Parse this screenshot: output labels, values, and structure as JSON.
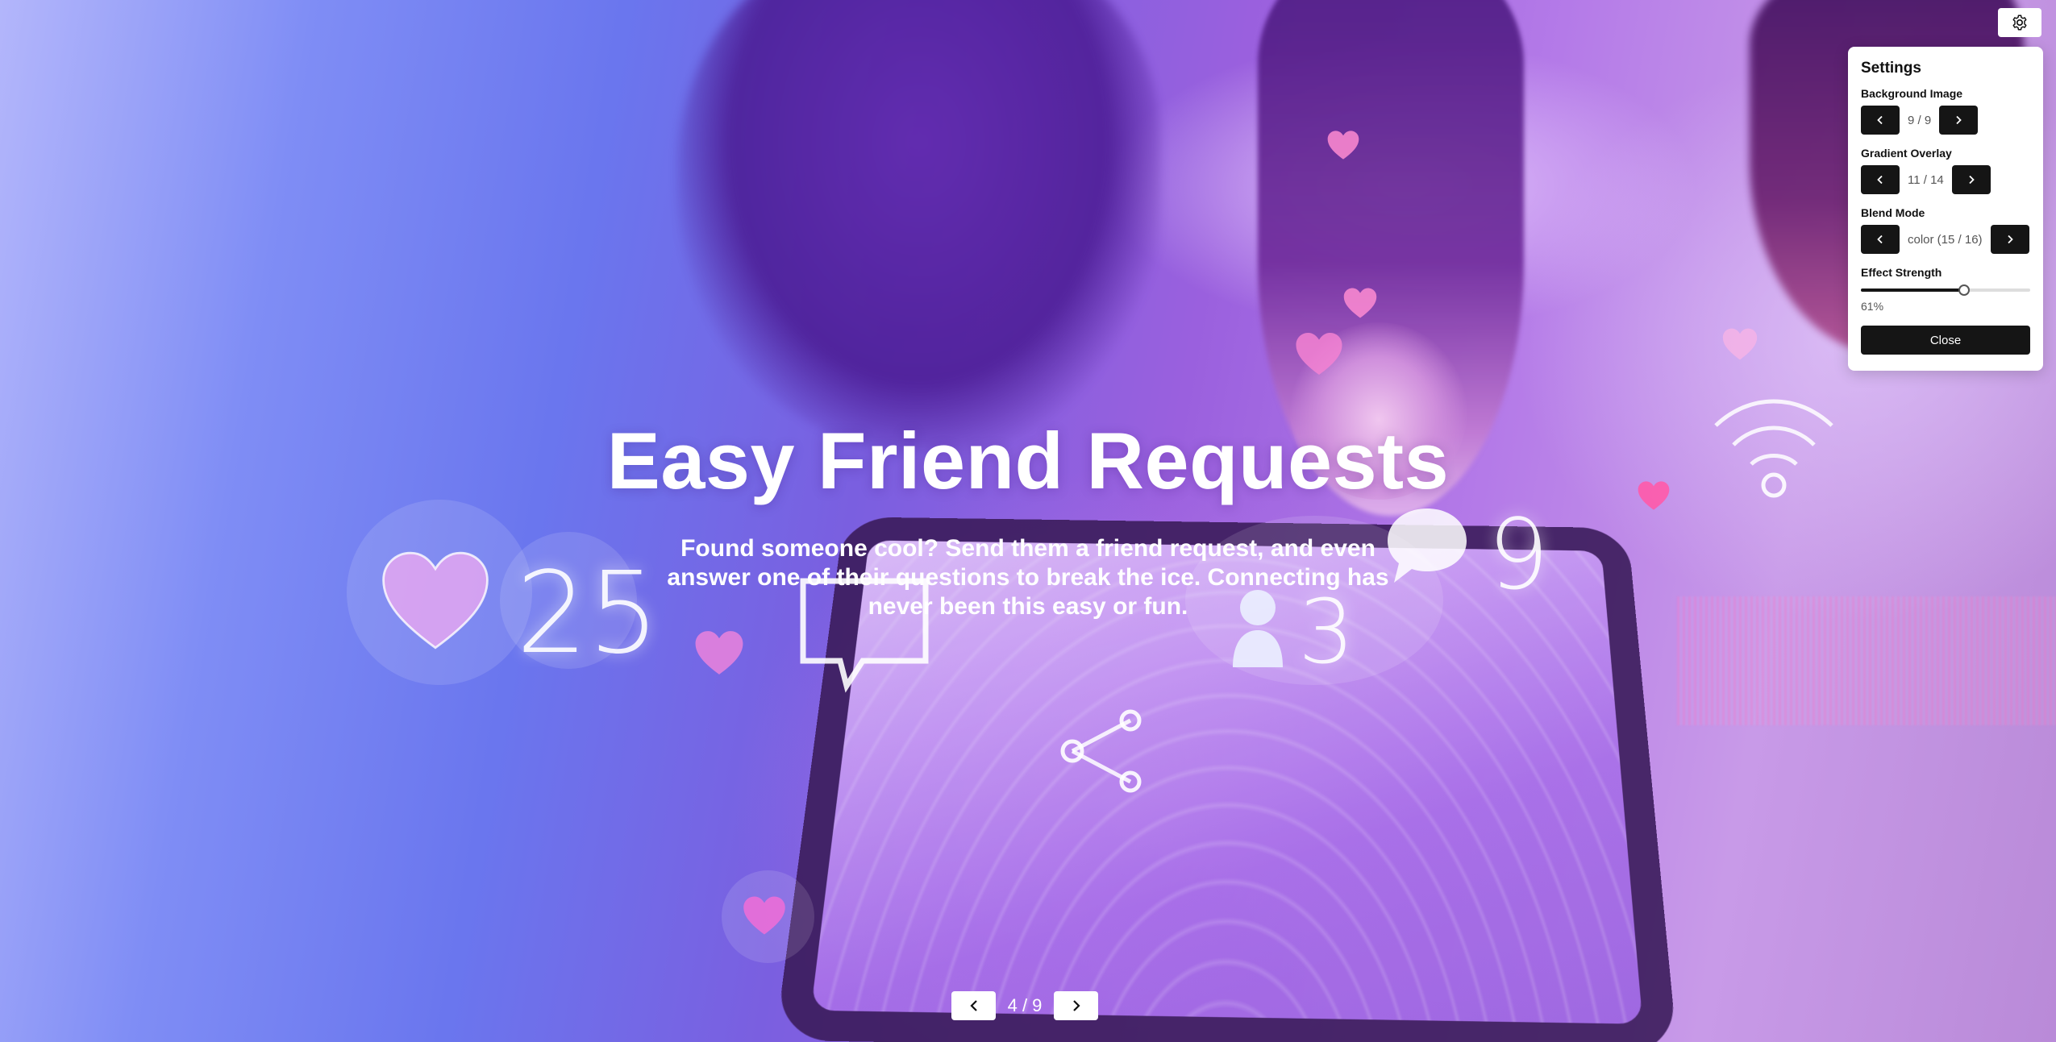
{
  "hero": {
    "title": "Easy Friend Requests",
    "text": "Found someone cool? Send them a friend request, and even answer one of their questions to break the ice. Connecting has never been this easy or fun."
  },
  "pager": {
    "counter": "4 / 9",
    "prev_icon": "chevron-left-icon",
    "next_icon": "chevron-right-icon"
  },
  "background_decor": {
    "like_count": "25",
    "friend_count": "3",
    "message_count": "9"
  },
  "settings": {
    "toggle_icon": "gear-icon",
    "title": "Settings",
    "background_image": {
      "label": "Background Image",
      "value": "9 / 9"
    },
    "gradient_overlay": {
      "label": "Gradient Overlay",
      "value": "11 / 14"
    },
    "blend_mode": {
      "label": "Blend Mode",
      "value": "color (15 / 16)"
    },
    "effect_strength": {
      "label": "Effect Strength",
      "value": "61%",
      "percent": 61
    },
    "close_label": "Close"
  },
  "colors": {
    "panel_button": "#151515",
    "panel_bg": "#ffffff",
    "text_light": "#ffffff"
  }
}
